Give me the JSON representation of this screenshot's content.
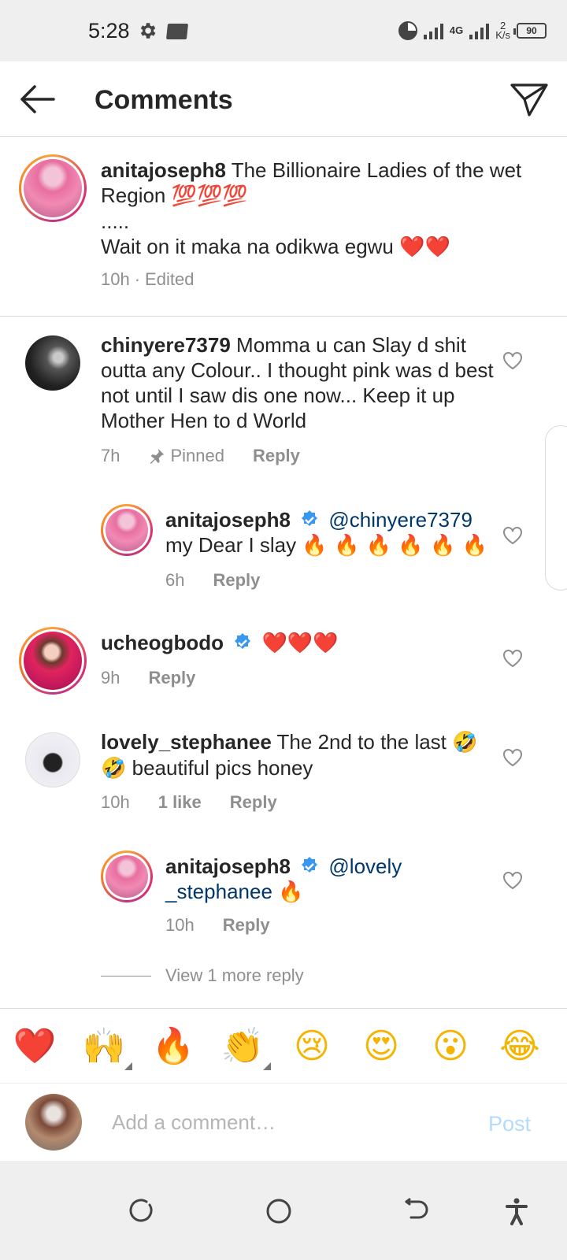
{
  "status_bar": {
    "time": "5:28",
    "network": "4G",
    "speed_value": "2",
    "speed_unit": "K/s",
    "battery": "90"
  },
  "header": {
    "title": "Comments"
  },
  "caption": {
    "username": "anitajoseph8",
    "text_line1": "The Billionaire Ladies of the wet Region",
    "text_line1_emoji": "💯💯💯",
    "dots": ".....",
    "text_line2": "Wait on it maka na odikwa egwu",
    "text_line2_emoji": "❤️❤️",
    "time": "10h",
    "edited": "Edited",
    "separator": "·"
  },
  "comments": [
    {
      "username": "chinyere7379",
      "text": "Momma u can Slay d shit outta any Colour.. I thought pink was d best not until I saw dis one now... Keep it up Mother Hen to d World",
      "time": "7h",
      "pinned": "Pinned",
      "reply": "Reply"
    },
    {
      "username": "anitajoseph8",
      "mention": "@chinyere7379",
      "text": "my Dear I slay",
      "emoji": "🔥 🔥 🔥 🔥 🔥 🔥",
      "time": "6h",
      "reply": "Reply"
    },
    {
      "username": "ucheogbodo",
      "emoji": "❤️❤️❤️",
      "time": "9h",
      "reply": "Reply"
    },
    {
      "username": "lovely_stephanee",
      "text_a": "The 2nd to the last",
      "emoji_a": "🤣",
      "emoji_b": "🤣",
      "text_b": "beautiful pics honey",
      "time": "10h",
      "likes": "1 like",
      "reply": "Reply"
    },
    {
      "username": "anitajoseph8",
      "mention_a": "@lovely",
      "mention_b": "_stephanee",
      "emoji": "🔥",
      "time": "10h",
      "reply": "Reply"
    }
  ],
  "view_more": "View 1 more reply",
  "emoji_bar": [
    "❤️",
    "🙌",
    "🔥",
    "👏",
    "😢",
    "😍",
    "😮",
    "😂"
  ],
  "composer": {
    "placeholder": "Add a comment…",
    "post_label": "Post"
  },
  "colors": {
    "link": "#00376b",
    "muted": "#8e8e8e",
    "post_disabled": "#b3dbff",
    "verified": "#3897f0"
  }
}
